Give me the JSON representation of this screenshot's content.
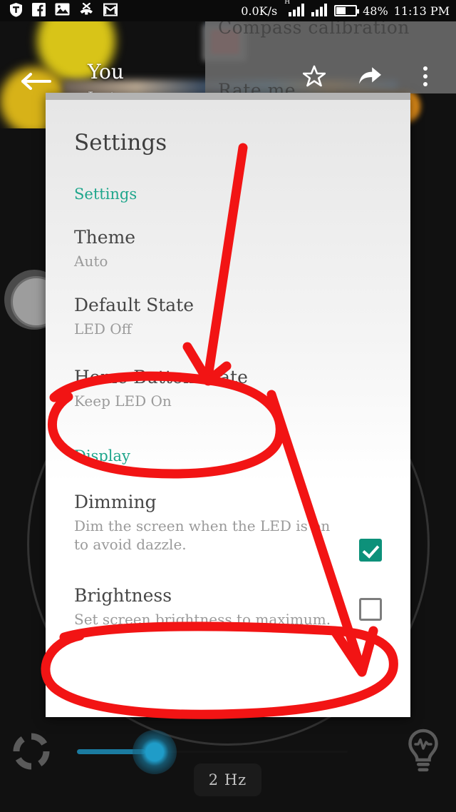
{
  "statusbar": {
    "icons": [
      "shield-vpn-icon",
      "facebook-icon",
      "gallery-image-icon",
      "missed-call-icon",
      "gmail-icon"
    ],
    "network_speed": "0.0K/s",
    "hspa_label": "H",
    "battery_percent": "48%",
    "clock": "11:13 PM"
  },
  "appbar": {
    "back_label": "back-arrow",
    "title": "You",
    "subtitle": "Just now",
    "actions": [
      "star-icon",
      "share-icon",
      "overflow-menu-icon"
    ]
  },
  "overflow_menu": {
    "items": [
      "Compass calibration",
      "Rate me"
    ]
  },
  "dialog": {
    "title": "Settings",
    "sections": [
      {
        "label": "Settings",
        "prefs": [
          {
            "title": "Theme",
            "subtitle": "Auto",
            "checkbox": null
          },
          {
            "title": "Default State",
            "subtitle": "LED Off",
            "checkbox": null
          },
          {
            "title": "Home Button State",
            "subtitle": "Keep LED On",
            "checkbox": null
          }
        ]
      },
      {
        "label": "Display",
        "prefs": [
          {
            "title": "Dimming",
            "subtitle": "Dim the screen when the LED is on to avoid dazzle.",
            "checkbox": "checked"
          },
          {
            "title": "Brightness",
            "subtitle": "Set screen brightness to maximum.",
            "checkbox": "unchecked"
          }
        ]
      }
    ]
  },
  "bottombar": {
    "left_icon": "color-wheel-icon",
    "right_icon": "lightbulb-pulse-icon",
    "frequency_label": "2 Hz",
    "slider_name": "frequency-slider"
  },
  "annotations": {
    "arrow_1_target": "Home Button State",
    "circle_1_target": "Home Button State",
    "arrow_2_target": "Brightness checkbox",
    "circle_2_target": "Brightness"
  },
  "colors": {
    "accent_teal": "#1fa68c",
    "checkbox_teal": "#0d917a",
    "slider_blue": "#1f9cc8",
    "annotation_red": "#f21414",
    "dialog_bg": "#ffffff"
  }
}
